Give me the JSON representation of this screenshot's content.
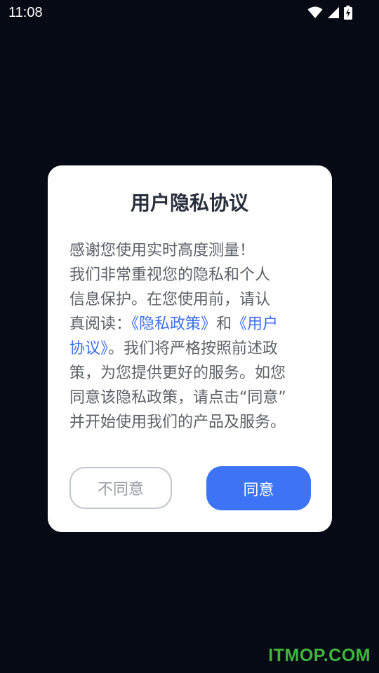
{
  "status_bar": {
    "time": "11:08",
    "icons": [
      "wifi-icon",
      "cellular-signal-icon",
      "battery-charging-icon"
    ]
  },
  "dialog": {
    "title": "用户隐私协议",
    "lines": [
      [
        {
          "text": "感谢您使用实时高度测量！",
          "link": false
        }
      ],
      [
        {
          "text": "我们非常重视您的隐私和个人",
          "link": false
        }
      ],
      [
        {
          "text": "信息保护。在您使用前，请认",
          "link": false
        }
      ],
      [
        {
          "text": "真阅读：",
          "link": false
        },
        {
          "text": "《隐私政策》",
          "link": true
        },
        {
          "text": "和",
          "link": false
        },
        {
          "text": "《用户",
          "link": true
        }
      ],
      [
        {
          "text": "协议》",
          "link": true
        },
        {
          "text": "。我们将严格按照前述政",
          "link": false
        }
      ],
      [
        {
          "text": "策，为您提供更好的服务。如您",
          "link": false
        }
      ],
      [
        {
          "text": "同意该隐私政策，请点击“同意”",
          "link": false
        }
      ],
      [
        {
          "text": "并开始使用我们的产品及服务。",
          "link": false
        }
      ]
    ],
    "disagree_label": "不同意",
    "agree_label": "同意"
  },
  "watermark": "ITMOP.COM",
  "colors": {
    "background": "#060a14",
    "dialog": "#ffffff",
    "title": "#2a2f3e",
    "body_text": "#5e6168",
    "link": "#3d6ff2",
    "agree_button": "#3c74f5",
    "disagree_border": "#c3c6cc",
    "watermark": "#3fb63e"
  }
}
